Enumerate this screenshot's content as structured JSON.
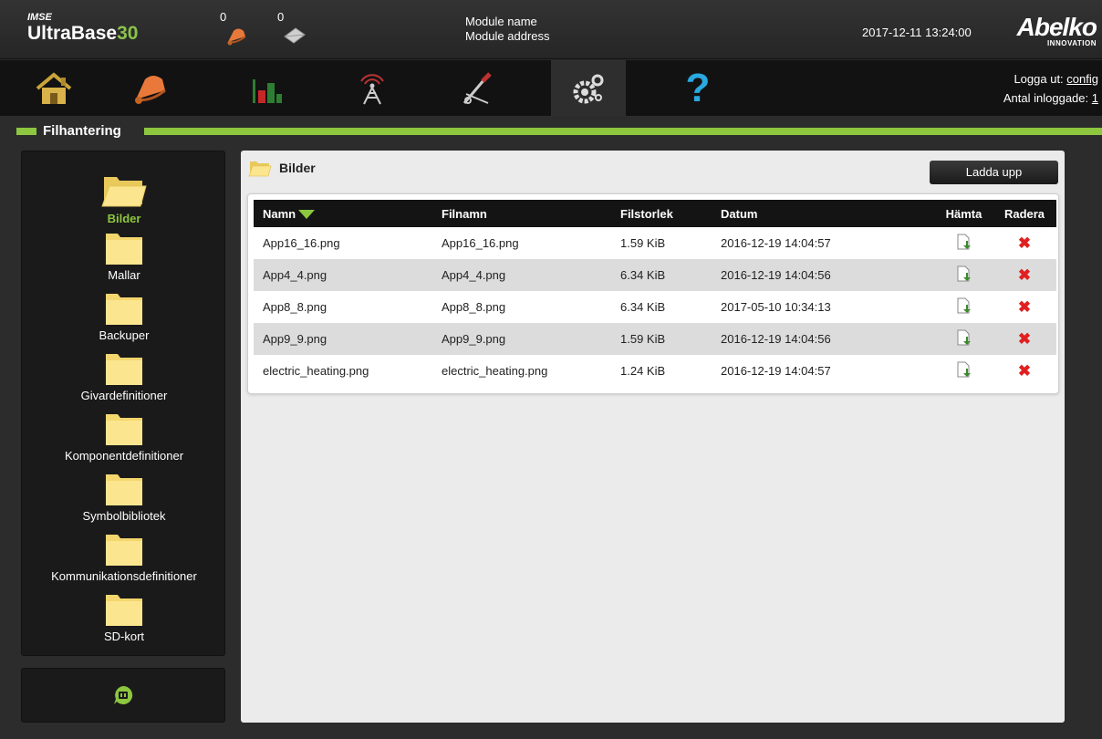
{
  "header": {
    "brand_small": "IMSE",
    "brand_name": "UltraBase",
    "brand_num": "30",
    "alarm_count": "0",
    "message_count": "0",
    "module_name": "Module name",
    "module_address": "Module address",
    "datetime": "2017-12-11 13:24:00",
    "logo_text": "Abelko",
    "logo_sub": "INNOVATION"
  },
  "nav": {
    "items": [
      {
        "name": "home-icon"
      },
      {
        "name": "alarm-bell-icon"
      },
      {
        "name": "bar-chart-icon"
      },
      {
        "name": "antenna-icon"
      },
      {
        "name": "tools-icon"
      },
      {
        "name": "settings-gears-icon",
        "active": true
      },
      {
        "name": "help-question-icon"
      }
    ],
    "logout_label": "Logga ut:",
    "logout_user": "config",
    "logged_in_label": "Antal inloggade:",
    "logged_in_count": "1"
  },
  "section": {
    "title": "Filhantering"
  },
  "sidebar": {
    "folders": [
      {
        "label": "Bilder",
        "active": true
      },
      {
        "label": "Mallar"
      },
      {
        "label": "Backuper"
      },
      {
        "label": "Givardefinitioner"
      },
      {
        "label": "Komponentdefinitioner"
      },
      {
        "label": "Symbolbibliotek"
      },
      {
        "label": "Kommunikationsdefinitioner"
      },
      {
        "label": "SD-kort"
      }
    ]
  },
  "main": {
    "title": "Bilder",
    "upload_label": "Ladda upp",
    "columns": [
      "Namn",
      "Filnamn",
      "Filstorlek",
      "Datum",
      "Hämta",
      "Radera"
    ],
    "rows": [
      {
        "name": "App16_16.png",
        "file": "App16_16.png",
        "size": "1.59 KiB",
        "date": "2016-12-19 14:04:57"
      },
      {
        "name": "App4_4.png",
        "file": "App4_4.png",
        "size": "6.34 KiB",
        "date": "2016-12-19 14:04:56"
      },
      {
        "name": "App8_8.png",
        "file": "App8_8.png",
        "size": "6.34 KiB",
        "date": "2017-05-10 10:34:13"
      },
      {
        "name": "App9_9.png",
        "file": "App9_9.png",
        "size": "1.59 KiB",
        "date": "2016-12-19 14:04:56"
      },
      {
        "name": "electric_heating.png",
        "file": "electric_heating.png",
        "size": "1.24 KiB",
        "date": "2016-12-19 14:04:57"
      }
    ],
    "delete_glyph": "✖"
  },
  "colors": {
    "accent": "#8dc63f",
    "delete": "#e02020"
  }
}
